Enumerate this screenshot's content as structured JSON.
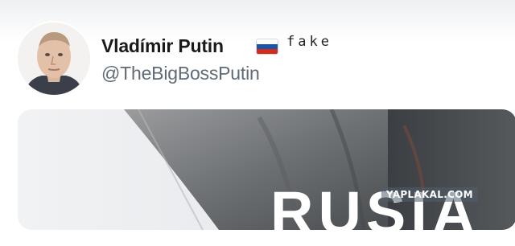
{
  "profile": {
    "display_name": "Vladímir Putin",
    "username": "@TheBigBossPutin",
    "overlay_label": "fake",
    "flag": "russia-flag-icon"
  },
  "media": {
    "headline": "RUSIA",
    "watermark": "YAPLAKAL.COM"
  },
  "colors": {
    "flag_white": "#ffffff",
    "flag_blue": "#1c57a7",
    "flag_red": "#d52b1e",
    "name_text": "#1a1a1a",
    "handle_text": "#5f6b76"
  }
}
